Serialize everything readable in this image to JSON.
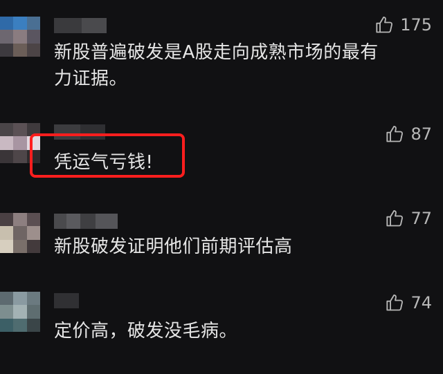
{
  "comments": [
    {
      "text": "新股普遍破发是A股走向成熟市场的最有力证据。",
      "likes": "175"
    },
    {
      "text": "凭运气亏钱!",
      "likes": "87"
    },
    {
      "text": "新股破发证明他们前期评估高",
      "likes": "77"
    },
    {
      "text": "定价高，破发没毛病。",
      "likes": "74"
    }
  ],
  "icons": {
    "like": "thumbs-up-icon"
  },
  "colors": {
    "background": "#111113",
    "text": "#e6e6e6",
    "like": "#b8b8b8",
    "highlight": "#ff1e1e"
  }
}
